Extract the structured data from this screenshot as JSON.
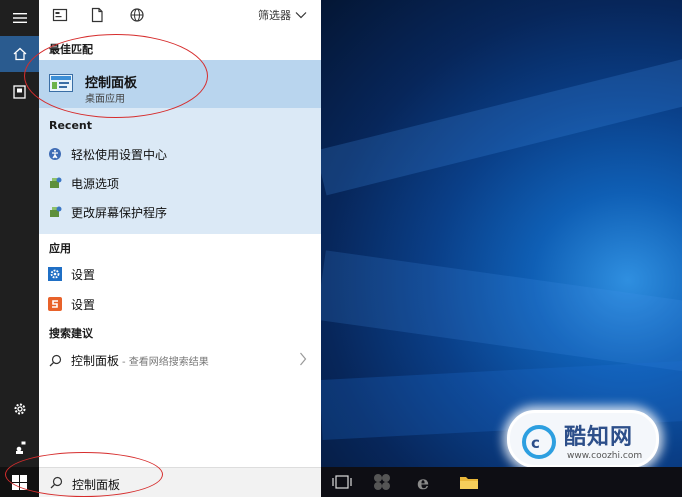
{
  "toolbar": {
    "filter_label": "筛选器"
  },
  "best_match": {
    "header": "最佳匹配",
    "title": "控制面板",
    "subtitle": "桌面应用"
  },
  "recent": {
    "header": "Recent",
    "items": [
      {
        "label": "轻松使用设置中心",
        "icon": "ease-of-access-icon"
      },
      {
        "label": "电源选项",
        "icon": "power-options-icon"
      },
      {
        "label": "更改屏幕保护程序",
        "icon": "screensaver-icon"
      }
    ]
  },
  "apps": {
    "header": "应用",
    "items": [
      {
        "label": "设置",
        "icon": "settings-gear-icon"
      },
      {
        "label": "设置",
        "icon": "settings-app-icon"
      }
    ]
  },
  "suggestions": {
    "header": "搜索建议",
    "item_label": "控制面板",
    "item_sub": "- 查看网络搜索结果"
  },
  "search": {
    "query": "控制面板"
  },
  "watermark": {
    "title": "酷知网",
    "url": "www.coozhi.com"
  },
  "colors": {
    "accent": "#2a5b8f",
    "best_match_bg": "#b9d5ee",
    "recent_bg": "#dbe9f6",
    "annotation": "#d62d2d"
  }
}
